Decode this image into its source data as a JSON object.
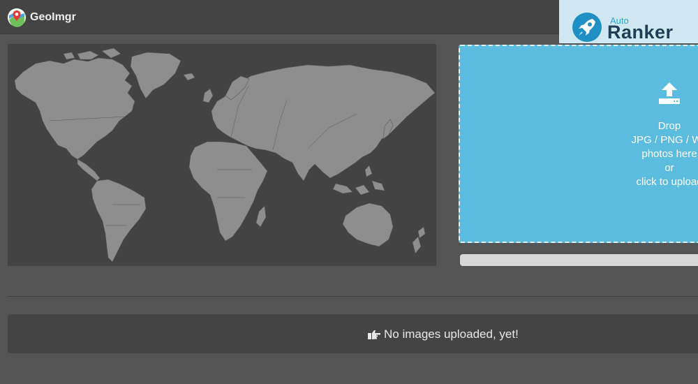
{
  "header": {
    "app_name": "GeoImgr",
    "logo_icon": "map-pin-logo-icon"
  },
  "ad": {
    "small": "Auto",
    "big": "Ranker",
    "icon": "rocket-icon",
    "colors": {
      "small": "#28a8d8",
      "big": "#1f3d56",
      "background": "#cfe8f1"
    }
  },
  "map": {
    "icon": "world-map"
  },
  "dropzone": {
    "icon": "upload-icon",
    "lines": [
      "Drop",
      "JPG / PNG / We",
      "photos here",
      "or",
      "click to upload"
    ],
    "color": "#5bbcdf"
  },
  "progress": {
    "value": 0
  },
  "gallery": {
    "icon": "hand-pointing-right-icon",
    "message": "No images uploaded, yet!"
  }
}
